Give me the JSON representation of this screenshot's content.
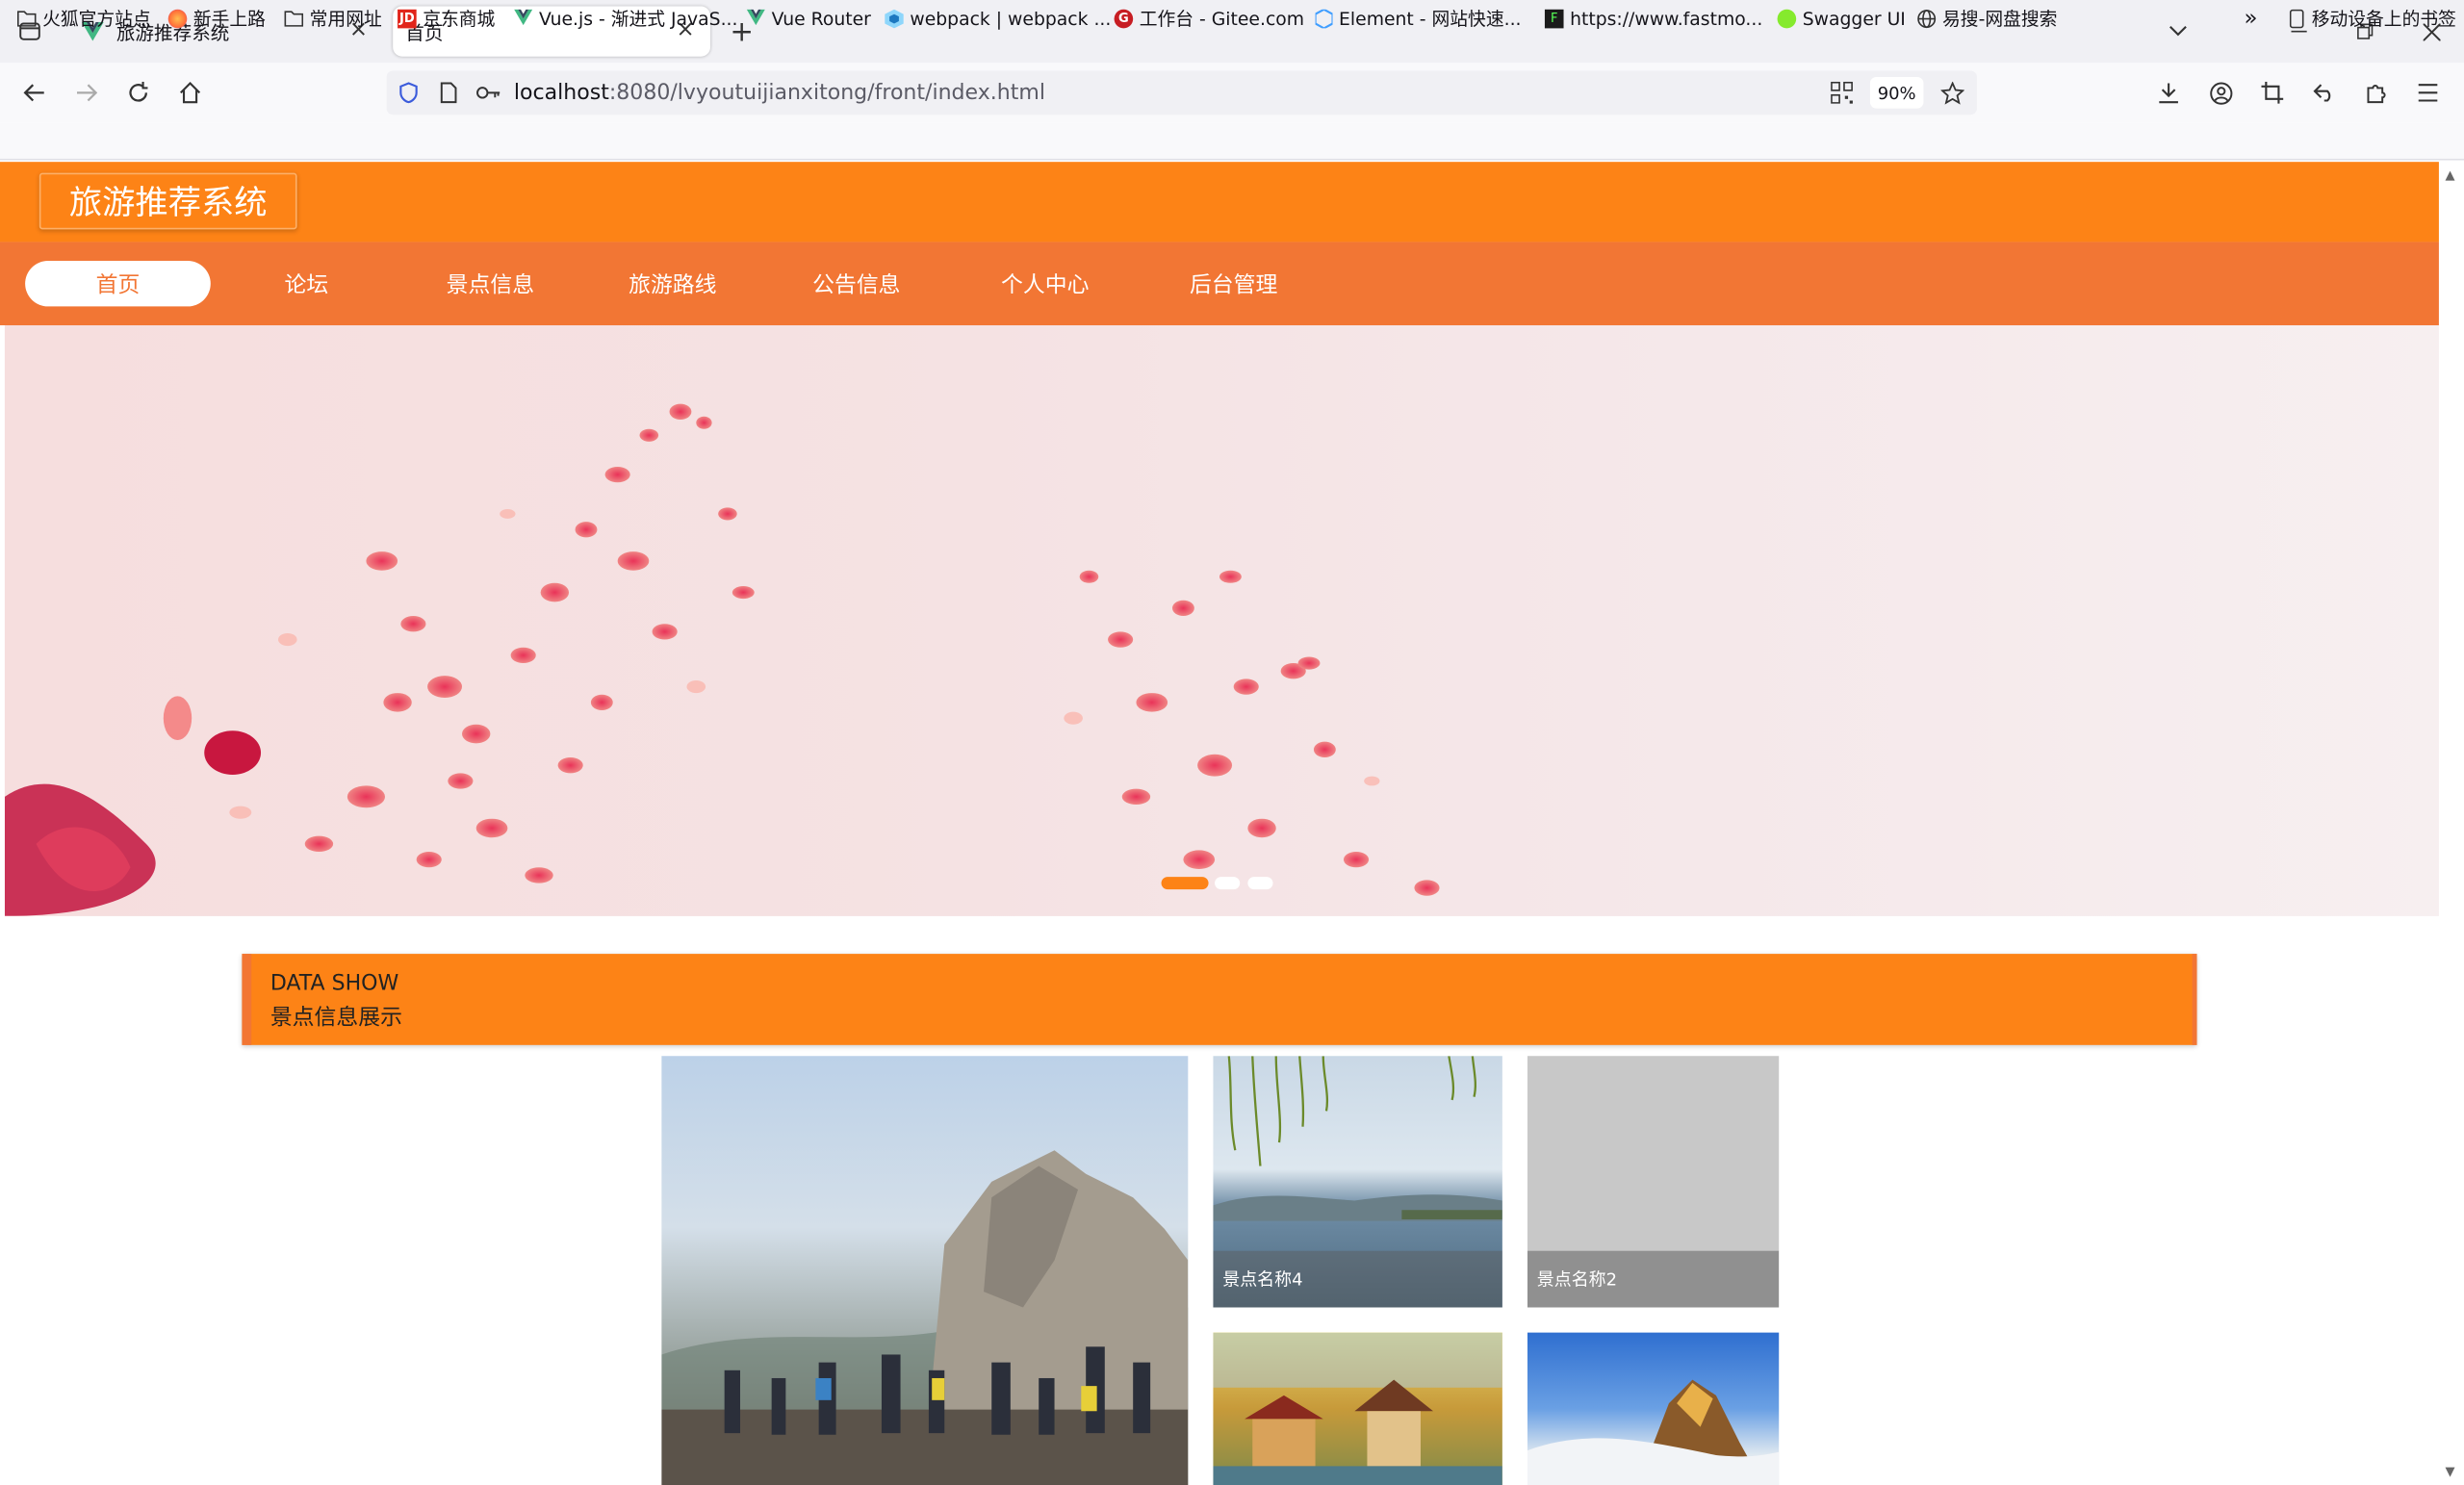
{
  "browser": {
    "tabs": [
      {
        "title": "旅游推荐系统",
        "close": "×"
      },
      {
        "title": "首页",
        "close": "×"
      }
    ],
    "new_tab": "+",
    "url_host": "localhost",
    "url_rest": ":8080/lvyoutuijianxitong/front/index.html",
    "zoom": "90%",
    "bookmarks": [
      "火狐官方站点",
      "新手上路",
      "常用网址",
      "京东商城",
      "Vue.js - 渐进式 JavaS...",
      "Vue Router",
      "webpack | webpack ...",
      "工作台 - Gitee.com",
      "Element - 网站快速...",
      "https://www.fastmo...",
      "Swagger UI",
      "易搜-网盘搜索"
    ],
    "bookmarks_more": "»",
    "mobile_bookmarks": "移动设备上的书签"
  },
  "site": {
    "brand": "旅游推荐系统",
    "menu": [
      "首页",
      "论坛",
      "景点信息",
      "旅游路线",
      "公告信息",
      "个人中心",
      "后台管理"
    ],
    "active_menu_index": 0,
    "carousel_slides": 3,
    "carousel_active": 0,
    "section": {
      "en": "DATA SHOW",
      "cn": "景点信息展示"
    },
    "cards": [
      {
        "caption": "景点名称4"
      },
      {
        "caption": "景点名称2"
      }
    ]
  },
  "colors": {
    "header": "#fd8316",
    "nav": "#f27634",
    "accent": "#fd8316"
  }
}
